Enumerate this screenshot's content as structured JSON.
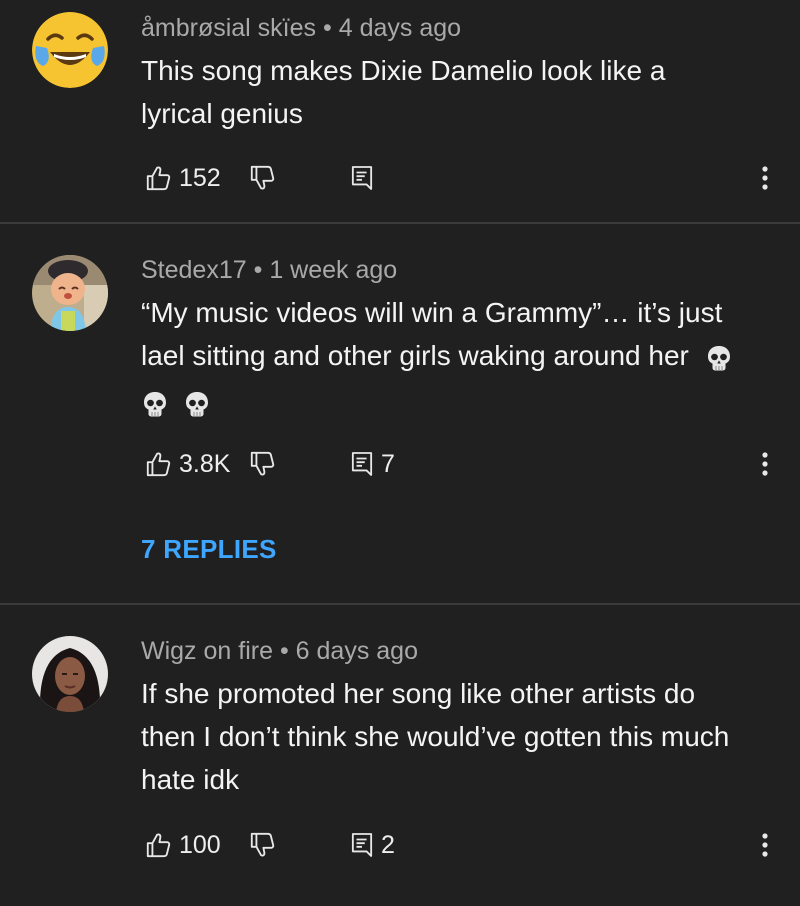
{
  "comments": [
    {
      "author": "åmbrøsial skïes",
      "time": "4 days ago",
      "lines": [
        "This song makes Dixie Damelio look like a",
        "lyrical genius"
      ],
      "likes": "152",
      "replies_count": "",
      "avatar_icon": "laughing-crying-emoji-icon"
    },
    {
      "author": "Stedex17",
      "time": "1 week ago",
      "lines": [
        "“My music videos will win a Grammy”… it’s just",
        "lael sitting and other girls waking around her"
      ],
      "likes": "3.8K",
      "replies_count": "7",
      "replies_link": "7 REPLIES",
      "avatar_icon": "game-character-avatar-icon"
    },
    {
      "author": "Wigz on fire",
      "time": "6 days ago",
      "lines": [
        "If she promoted her song like other artists do",
        "then I don’t think she would’ve gotten this much",
        "hate idk"
      ],
      "likes": "100",
      "replies_count": "2",
      "avatar_icon": "profile-photo-avatar-icon"
    }
  ],
  "separator": "•",
  "icons": {
    "like": "thumbs-up-icon",
    "dislike": "thumbs-down-icon",
    "reply": "reply-comment-icon",
    "more": "more-vertical-icon",
    "emoji": "skull-emoji-icon"
  },
  "colors": {
    "background": "#202020",
    "link": "#3ea6ff",
    "meta": "#a9a9a9",
    "divider": "#3a3a3a"
  }
}
